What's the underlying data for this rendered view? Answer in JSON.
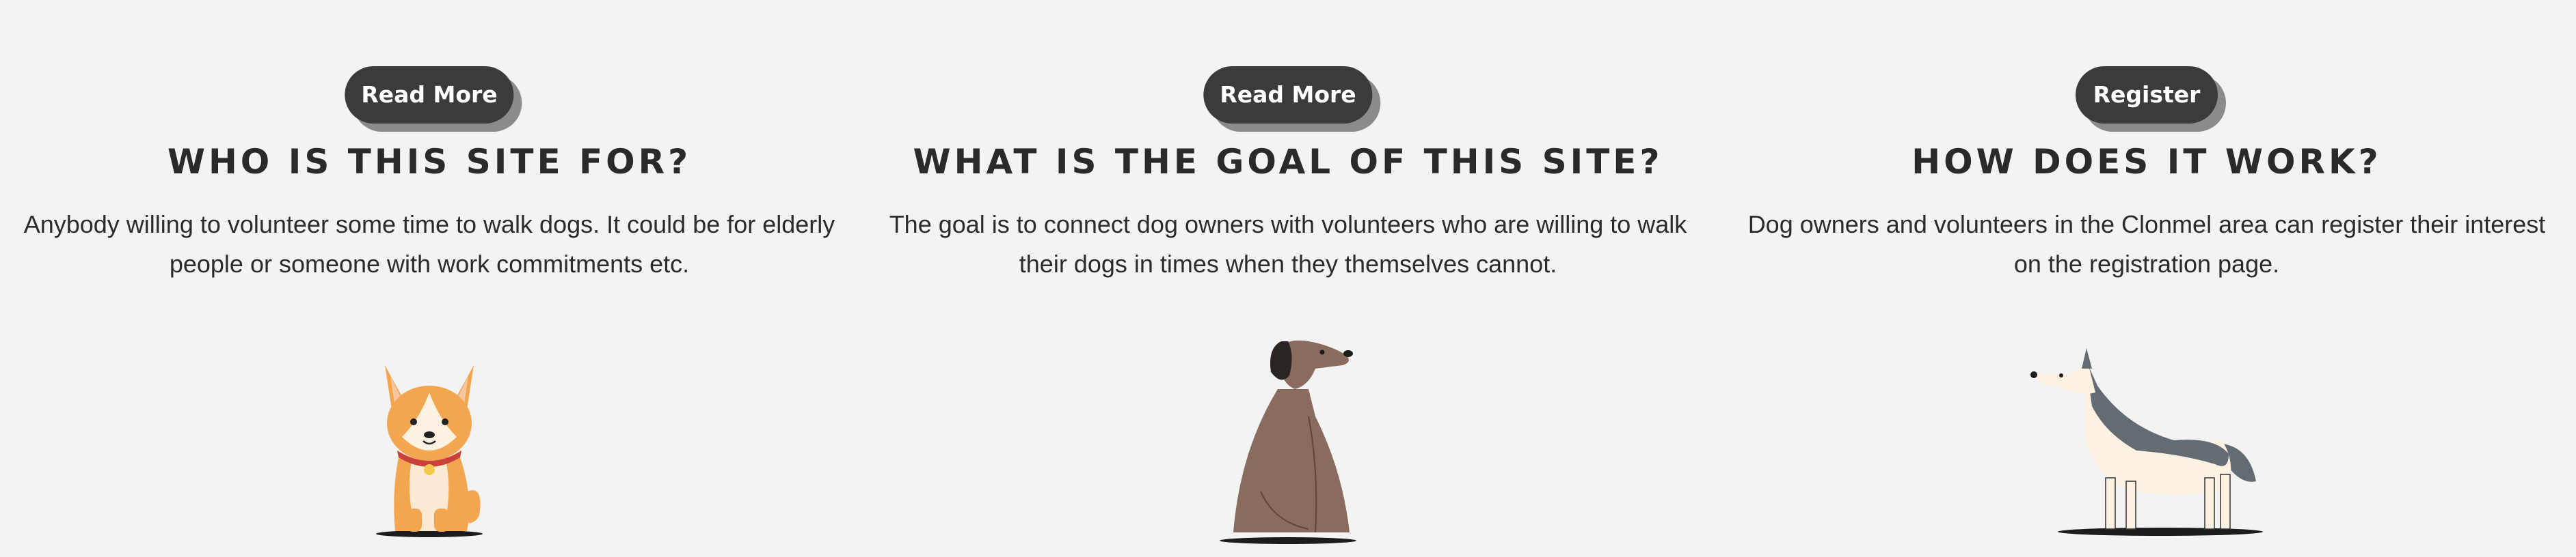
{
  "cards": [
    {
      "button_label": "Read More",
      "title": "WHO IS THIS SITE FOR?",
      "description": "Anybody willing to volunteer some time to walk dogs. It could be for elderly people or someone with work commitments etc.",
      "image_icon": "corgi-dog-illustration"
    },
    {
      "button_label": "Read More",
      "title": "WHAT IS THE GOAL OF THIS SITE?",
      "description": "The goal is to connect dog owners with volunteers who are willing to walk their dogs in times when they themselves cannot.",
      "image_icon": "brown-dog-illustration"
    },
    {
      "button_label": "Register",
      "title": "HOW DOES IT WORK?",
      "description": "Dog owners and volunteers in the Clonmel area can register their interest on the registration page.",
      "image_icon": "husky-dog-illustration"
    }
  ],
  "colors": {
    "background": "#f3f3f3",
    "button": "#3b3b3b",
    "button_shadow": "#8b8b8b",
    "text": "#2b2b2b"
  }
}
